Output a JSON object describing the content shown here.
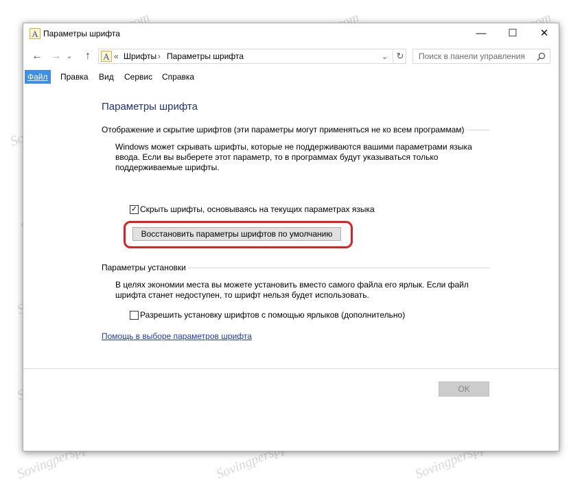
{
  "window": {
    "title": "Параметры шрифта",
    "controls": {
      "minimize": "—",
      "maximize": "☐",
      "close": "✕"
    }
  },
  "address_bar": {
    "nav": {
      "back": "←",
      "forward": "→",
      "dropdown": "⌄",
      "up": "↑"
    },
    "prefix": "«",
    "breadcrumb": [
      "Шрифты",
      "Параметры шрифта"
    ],
    "separator": "›",
    "refresh": "↻",
    "search_placeholder": "Поиск в панели управления"
  },
  "menu": [
    {
      "label": "Файл",
      "active": true
    },
    {
      "label": "Правка",
      "active": false
    },
    {
      "label": "Вид",
      "active": false
    },
    {
      "label": "Сервис",
      "active": false
    },
    {
      "label": "Справка",
      "active": false
    }
  ],
  "main": {
    "page_title": "Параметры шрифта",
    "display_section": {
      "heading": "Отображение и скрытие шрифтов (эти параметры могут применяться не ко всем программам)",
      "description_lines": [
        "Windows может скрывать шрифты, которые не поддерживаются вашими параметрами языка",
        "ввода. Если вы выберете этот параметр, то в программах будут указываться только",
        "поддерживаемые шрифты."
      ],
      "hide_fonts_checkbox": {
        "label": "Скрыть шрифты, основываясь на текущих параметрах языка",
        "checked": true
      },
      "restore_button": "Восстановить параметры шрифтов по умолчанию"
    },
    "install_section": {
      "heading": "Параметры установки",
      "description_lines": [
        "В целях экономии места вы можете установить вместо самого файла его ярлык. Если файл",
        "шрифта станет недоступен, то шрифт нельзя будет использовать."
      ],
      "shortcut_checkbox": {
        "label": "Разрешить установку шрифтов с помощью ярлыков (дополнительно)",
        "checked": false
      }
    },
    "help_link": "Помощь в выборе параметров шрифта"
  },
  "footer": {
    "ok_label": "OK",
    "ok_enabled": false
  },
  "watermark_text": "Sovingpersppair.com",
  "colors": {
    "highlight": "#e02020",
    "menu_active": "#3c8ee6",
    "title_blue": "#1e3287",
    "link": "#1e3cb4"
  }
}
